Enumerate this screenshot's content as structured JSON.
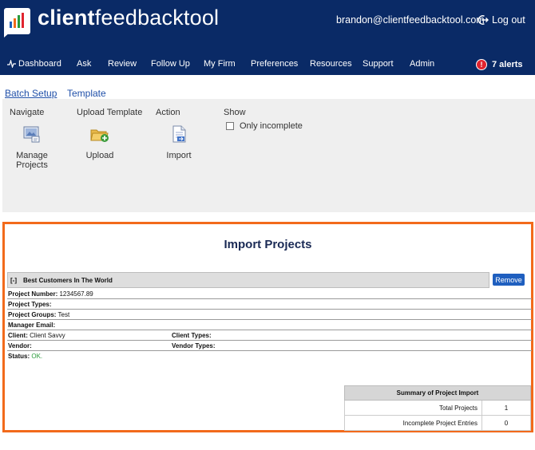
{
  "brand": {
    "name_bold": "client",
    "name_light": "feedbacktool",
    "bar_colors": [
      "#1f5fbf",
      "#f26a1b",
      "#2a9b3a",
      "#e0242f"
    ]
  },
  "user": {
    "email": "brandon@clientfeedbacktool.com",
    "logout_label": "Log out"
  },
  "nav": {
    "items": [
      {
        "label": "Dashboard",
        "icon": "pulse-icon"
      },
      {
        "label": "Ask"
      },
      {
        "label": "Review"
      },
      {
        "label": "Follow Up"
      },
      {
        "label": "My Firm"
      },
      {
        "label": "Preferences"
      },
      {
        "label": "Resources"
      },
      {
        "label": "Support"
      },
      {
        "label": "Admin"
      }
    ],
    "alerts": {
      "badge": "!",
      "label": "7 alerts"
    }
  },
  "subtabs": [
    {
      "label": "Batch Setup",
      "active": true
    },
    {
      "label": "Template",
      "active": false
    }
  ],
  "toolbar": {
    "navigate_title": "Navigate",
    "upload_title": "Upload Template",
    "action_title": "Action",
    "show_title": "Show",
    "manage_projects_line1": "Manage",
    "manage_projects_line2": "Projects",
    "upload_label": "Upload",
    "import_label": "Import",
    "only_incomplete_label": "Only incomplete",
    "only_incomplete_checked": false
  },
  "import": {
    "title": "Import Projects",
    "project": {
      "toggle": "[-]",
      "name": "Best Customers In The World",
      "remove_label": "Remove",
      "number_label": "Project Number:",
      "number": "1234567.89",
      "types_label": "Project Types:",
      "types": "",
      "groups_label": "Project Groups:",
      "groups": "Test",
      "manager_email_label": "Manager Email:",
      "manager_email": "",
      "client_label": "Client:",
      "client": "Client Savvy",
      "client_types_label": "Client Types:",
      "client_types": "",
      "vendor_label": "Vendor:",
      "vendor": "",
      "vendor_types_label": "Vendor Types:",
      "vendor_types": "",
      "status_label": "Status:",
      "status": "OK.",
      "status_color": "#2a9b3a"
    },
    "summary": {
      "title": "Summary of Project Import",
      "rows": [
        {
          "label": "Total Projects",
          "value": "1"
        },
        {
          "label": "Incomplete Project Entries",
          "value": "0"
        }
      ]
    }
  },
  "colors": {
    "header_bg": "#0a2a66",
    "accent_orange": "#f26a1b",
    "link_blue": "#1f4fa8",
    "button_blue": "#1f5fbf",
    "alert_red": "#e0242f"
  }
}
